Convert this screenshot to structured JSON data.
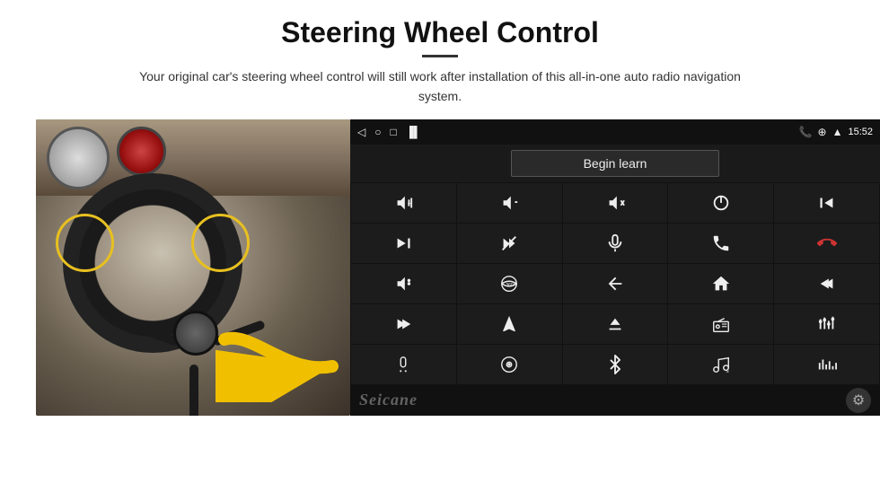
{
  "header": {
    "title": "Steering Wheel Control",
    "subtitle": "Your original car's steering wheel control will still work after installation of this all-in-one auto radio navigation system."
  },
  "android_ui": {
    "statusbar": {
      "back_icon": "◁",
      "circle_icon": "○",
      "square_icon": "□",
      "signal_icon": "▐▌",
      "phone_icon": "📞",
      "location_icon": "⊕",
      "wifi_icon": "▲",
      "time": "15:52"
    },
    "begin_learn_label": "Begin learn",
    "controls": [
      {
        "id": "vol-up",
        "icon": "vol-up"
      },
      {
        "id": "vol-down",
        "icon": "vol-down"
      },
      {
        "id": "mute",
        "icon": "mute"
      },
      {
        "id": "power",
        "icon": "power"
      },
      {
        "id": "prev-track",
        "icon": "prev-track"
      },
      {
        "id": "next",
        "icon": "next"
      },
      {
        "id": "fast-forward",
        "icon": "fast-forward"
      },
      {
        "id": "mic",
        "icon": "mic"
      },
      {
        "id": "phone",
        "icon": "phone"
      },
      {
        "id": "end-call",
        "icon": "end-call"
      },
      {
        "id": "speaker",
        "icon": "speaker"
      },
      {
        "id": "360",
        "icon": "360"
      },
      {
        "id": "back",
        "icon": "back"
      },
      {
        "id": "home",
        "icon": "home"
      },
      {
        "id": "skip-back",
        "icon": "skip-back"
      },
      {
        "id": "skip-next",
        "icon": "skip-next"
      },
      {
        "id": "navigate",
        "icon": "navigate"
      },
      {
        "id": "eject",
        "icon": "eject"
      },
      {
        "id": "radio",
        "icon": "radio"
      },
      {
        "id": "eq",
        "icon": "eq"
      },
      {
        "id": "mic2",
        "icon": "mic2"
      },
      {
        "id": "disc",
        "icon": "disc"
      },
      {
        "id": "bluetooth",
        "icon": "bluetooth"
      },
      {
        "id": "music",
        "icon": "music"
      },
      {
        "id": "spectrum",
        "icon": "spectrum"
      }
    ],
    "seicane_label": "Seicane",
    "gear_icon": "⚙"
  }
}
